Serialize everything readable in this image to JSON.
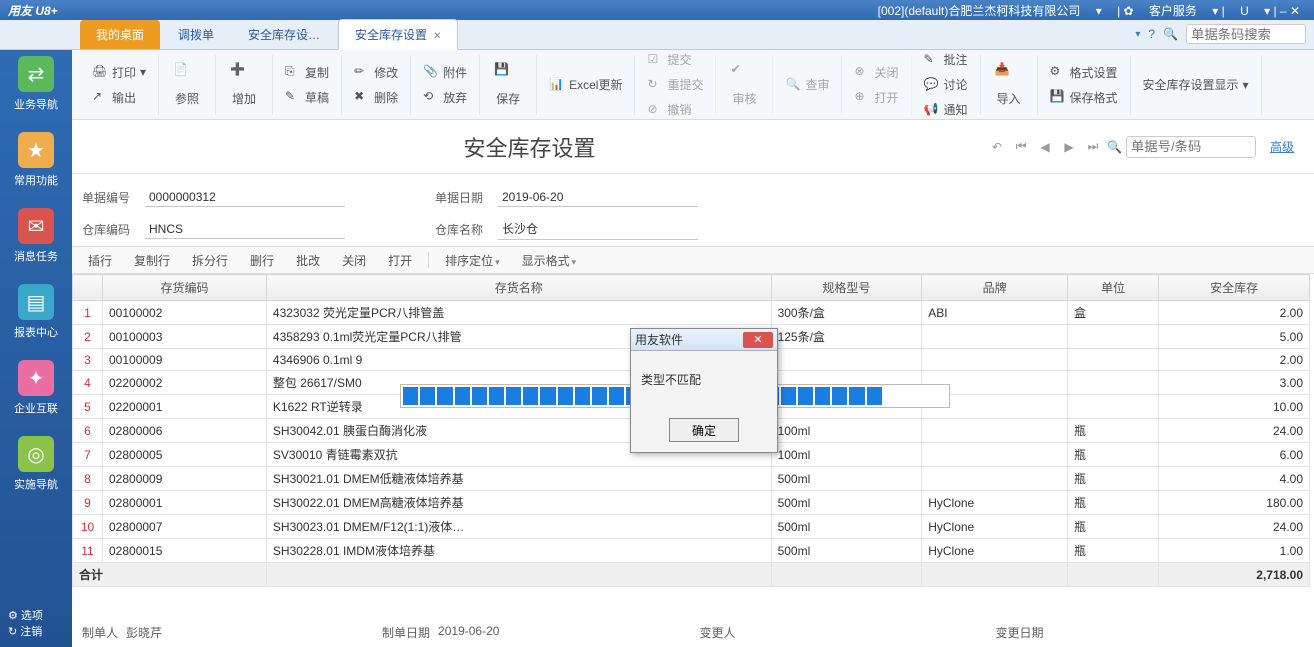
{
  "topbar": {
    "logo": "用友 U8+",
    "company": "[002](default)合肥兰杰柯科技有限公司",
    "service": "客户服务",
    "u": "U"
  },
  "tabs": {
    "t0": "我的桌面",
    "t1": "调拨单",
    "t2": "安全库存设…",
    "t3": "安全库存设置"
  },
  "tabright": {
    "help": "?",
    "search_placeholder": "单据条码搜索"
  },
  "sidebar": {
    "s0": "业务导航",
    "s1": "常用功能",
    "s2": "消息任务",
    "s3": "报表中心",
    "s4": "企业互联",
    "s5": "实施导航",
    "opt": "选项",
    "reg": "注销"
  },
  "toolbar": {
    "print": "打印",
    "output": "输出",
    "ref": "参照",
    "add": "增加",
    "copy": "复制",
    "edit": "修改",
    "draft": "草稿",
    "del": "删除",
    "attach": "附件",
    "discard": "放弃",
    "save": "保存",
    "excel": "Excel更新",
    "submit": "提交",
    "resubmit": "重提交",
    "unsubmit": "撤销",
    "audit": "审核",
    "check": "查审",
    "close": "关闭",
    "open": "打开",
    "note": "批注",
    "discuss": "讨论",
    "notify": "通知",
    "import": "导入",
    "fmtset": "格式设置",
    "showset": "安全库存设置显示",
    "savefmt": "保存格式"
  },
  "title": "安全库存设置",
  "nav": {
    "search_placeholder": "单据号/条码",
    "adv": "高级"
  },
  "form": {
    "bill_no_label": "单据编号",
    "bill_no": "0000000312",
    "bill_date_label": "单据日期",
    "bill_date": "2019-06-20",
    "wh_code_label": "仓库编码",
    "wh_code": "HNCS",
    "wh_name_label": "仓库名称",
    "wh_name": "长沙仓"
  },
  "actions": {
    "insrow": "插行",
    "cpyrow": "复制行",
    "splitrow": "拆分行",
    "delrow": "删行",
    "batch": "批改",
    "close": "关闭",
    "open": "打开",
    "sort": "排序定位",
    "disp": "显示格式"
  },
  "columns": {
    "c1": "存货编码",
    "c2": "存货名称",
    "c3": "规格型号",
    "c4": "品牌",
    "c5": "单位",
    "c6": "安全库存"
  },
  "rows": [
    {
      "n": "1",
      "code": "00100002",
      "name": "4323032 荧光定量PCR八排管盖",
      "spec": "300条/盒",
      "brand": "ABI",
      "unit": "盒",
      "qty": "2.00"
    },
    {
      "n": "2",
      "code": "00100003",
      "name": "4358293 0.1ml荧光定量PCR八排管",
      "spec": "125条/盒",
      "brand": "",
      "unit": "",
      "qty": "5.00"
    },
    {
      "n": "3",
      "code": "00100009",
      "name": "4346906 0.1ml 9",
      "spec": "",
      "brand": "",
      "unit": "",
      "qty": "2.00"
    },
    {
      "n": "4",
      "code": "02200002",
      "name": "整包 26617/SM0",
      "spec": "",
      "brand": "",
      "unit": "",
      "qty": "3.00"
    },
    {
      "n": "5",
      "code": "02200001",
      "name": "K1622 RT逆转录",
      "spec": "",
      "brand": "",
      "unit": "",
      "qty": "10.00"
    },
    {
      "n": "6",
      "code": "02800006",
      "name": "SH30042.01 胰蛋白酶消化液",
      "spec": "100ml",
      "brand": "",
      "unit": "瓶",
      "qty": "24.00"
    },
    {
      "n": "7",
      "code": "02800005",
      "name": "SV30010 青链霉素双抗",
      "spec": "100ml",
      "brand": "",
      "unit": "瓶",
      "qty": "6.00"
    },
    {
      "n": "8",
      "code": "02800009",
      "name": "SH30021.01 DMEM低糖液体培养基",
      "spec": "500ml",
      "brand": "",
      "unit": "瓶",
      "qty": "4.00"
    },
    {
      "n": "9",
      "code": "02800001",
      "name": "SH30022.01 DMEM高糖液体培养基",
      "spec": "500ml",
      "brand": "HyClone",
      "unit": "瓶",
      "qty": "180.00"
    },
    {
      "n": "10",
      "code": "02800007",
      "name": "SH30023.01 DMEM/F12(1:1)液体…",
      "spec": "500ml",
      "brand": "HyClone",
      "unit": "瓶",
      "qty": "24.00"
    },
    {
      "n": "11",
      "code": "02800015",
      "name": "SH30228.01 IMDM液体培养基",
      "spec": "500ml",
      "brand": "HyClone",
      "unit": "瓶",
      "qty": "1.00"
    }
  ],
  "total_label": "合计",
  "total_qty": "2,718.00",
  "footer": {
    "maker_label": "制单人",
    "maker": "彭晓芹",
    "makedate_label": "制单日期",
    "makedate": "2019-06-20",
    "changer_label": "变更人",
    "changedate_label": "变更日期"
  },
  "dialog": {
    "title": "用友软件",
    "msg": "类型不匹配",
    "ok": "确定"
  }
}
